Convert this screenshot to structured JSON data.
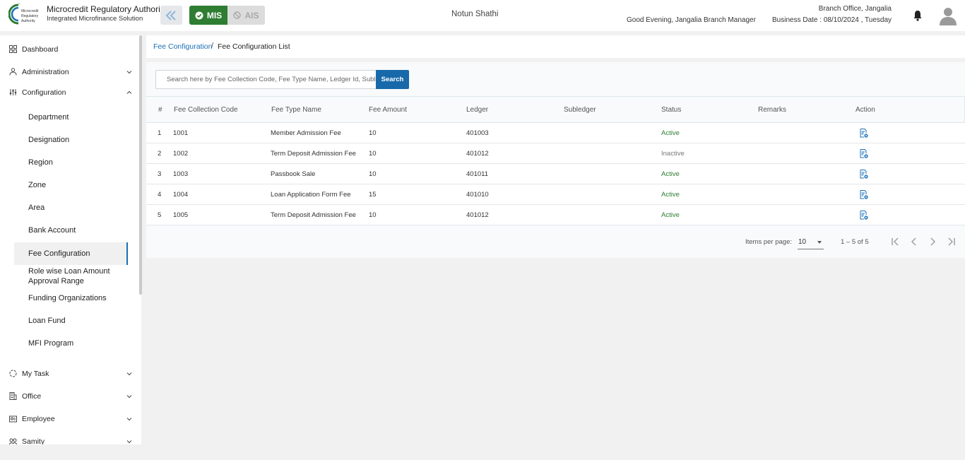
{
  "header": {
    "org_name": "Microcredit Regulatory Authority",
    "org_subtitle": "Integrated Microfinance Solution",
    "logo_text_lines": [
      "Microcredit",
      "Regulatory",
      "Authority"
    ],
    "mode_mis": "MIS",
    "mode_ais": "AIS",
    "app_name": "Notun Shathi",
    "greeting": "Good Evening, Jangalia Branch Manager",
    "branch": "Branch Office, Jangalia",
    "business_date": "Business Date : 08/10/2024 , Tuesday"
  },
  "sidebar": {
    "top_items": [
      {
        "label": "Dashboard",
        "icon": "grid-icon"
      },
      {
        "label": "Administration",
        "icon": "admin-icon"
      },
      {
        "label": "Configuration",
        "icon": "sliders-icon"
      }
    ],
    "config_items": [
      "Department",
      "Designation",
      "Region",
      "Zone",
      "Area",
      "Bank Account",
      "Fee Configuration",
      "Role wise Loan Amount Approval Range",
      "Funding Organizations",
      "Loan Fund",
      "MFI Program"
    ],
    "bottom_items": [
      {
        "label": "My Task",
        "icon": "task-icon"
      },
      {
        "label": "Office",
        "icon": "office-icon"
      },
      {
        "label": "Employee",
        "icon": "employee-icon"
      },
      {
        "label": "Samity",
        "icon": "samity-icon"
      }
    ]
  },
  "breadcrumb": {
    "parent": "Fee Configuration",
    "separator": "/",
    "current": "Fee Configuration List"
  },
  "search": {
    "placeholder": "Search here by Fee Collection Code, Fee Type Name, Ledger Id, Subledger",
    "button": "Search"
  },
  "table": {
    "headers": [
      "#",
      "Fee Collection Code",
      "Fee Type Name",
      "Fee Amount",
      "Ledger",
      "Subledger",
      "Status",
      "Remarks",
      "Action"
    ],
    "rows": [
      {
        "no": "1",
        "code": "1001",
        "type": "Member Admission Fee",
        "amount": "10",
        "ledger": "401003",
        "subledger": "",
        "status": "Active",
        "remarks": ""
      },
      {
        "no": "2",
        "code": "1002",
        "type": "Term Deposit Admission Fee",
        "amount": "10",
        "ledger": "401012",
        "subledger": "",
        "status": "Inactive",
        "remarks": ""
      },
      {
        "no": "3",
        "code": "1003",
        "type": "Passbook Sale",
        "amount": "10",
        "ledger": "401011",
        "subledger": "",
        "status": "Active",
        "remarks": ""
      },
      {
        "no": "4",
        "code": "1004",
        "type": "Loan Application Form Fee",
        "amount": "15",
        "ledger": "401010",
        "subledger": "",
        "status": "Active",
        "remarks": ""
      },
      {
        "no": "5",
        "code": "1005",
        "type": "Term Deposit Admission Fee",
        "amount": "10",
        "ledger": "401012",
        "subledger": "",
        "status": "Active",
        "remarks": ""
      }
    ]
  },
  "paginator": {
    "items_label": "Items per page:",
    "page_size": "10",
    "range": "1 – 5 of 5"
  },
  "colors": {
    "primary": "#1769aa",
    "mis_green": "#2e7d32",
    "active_status": "#2e7d32",
    "inactive_status": "#777777"
  }
}
